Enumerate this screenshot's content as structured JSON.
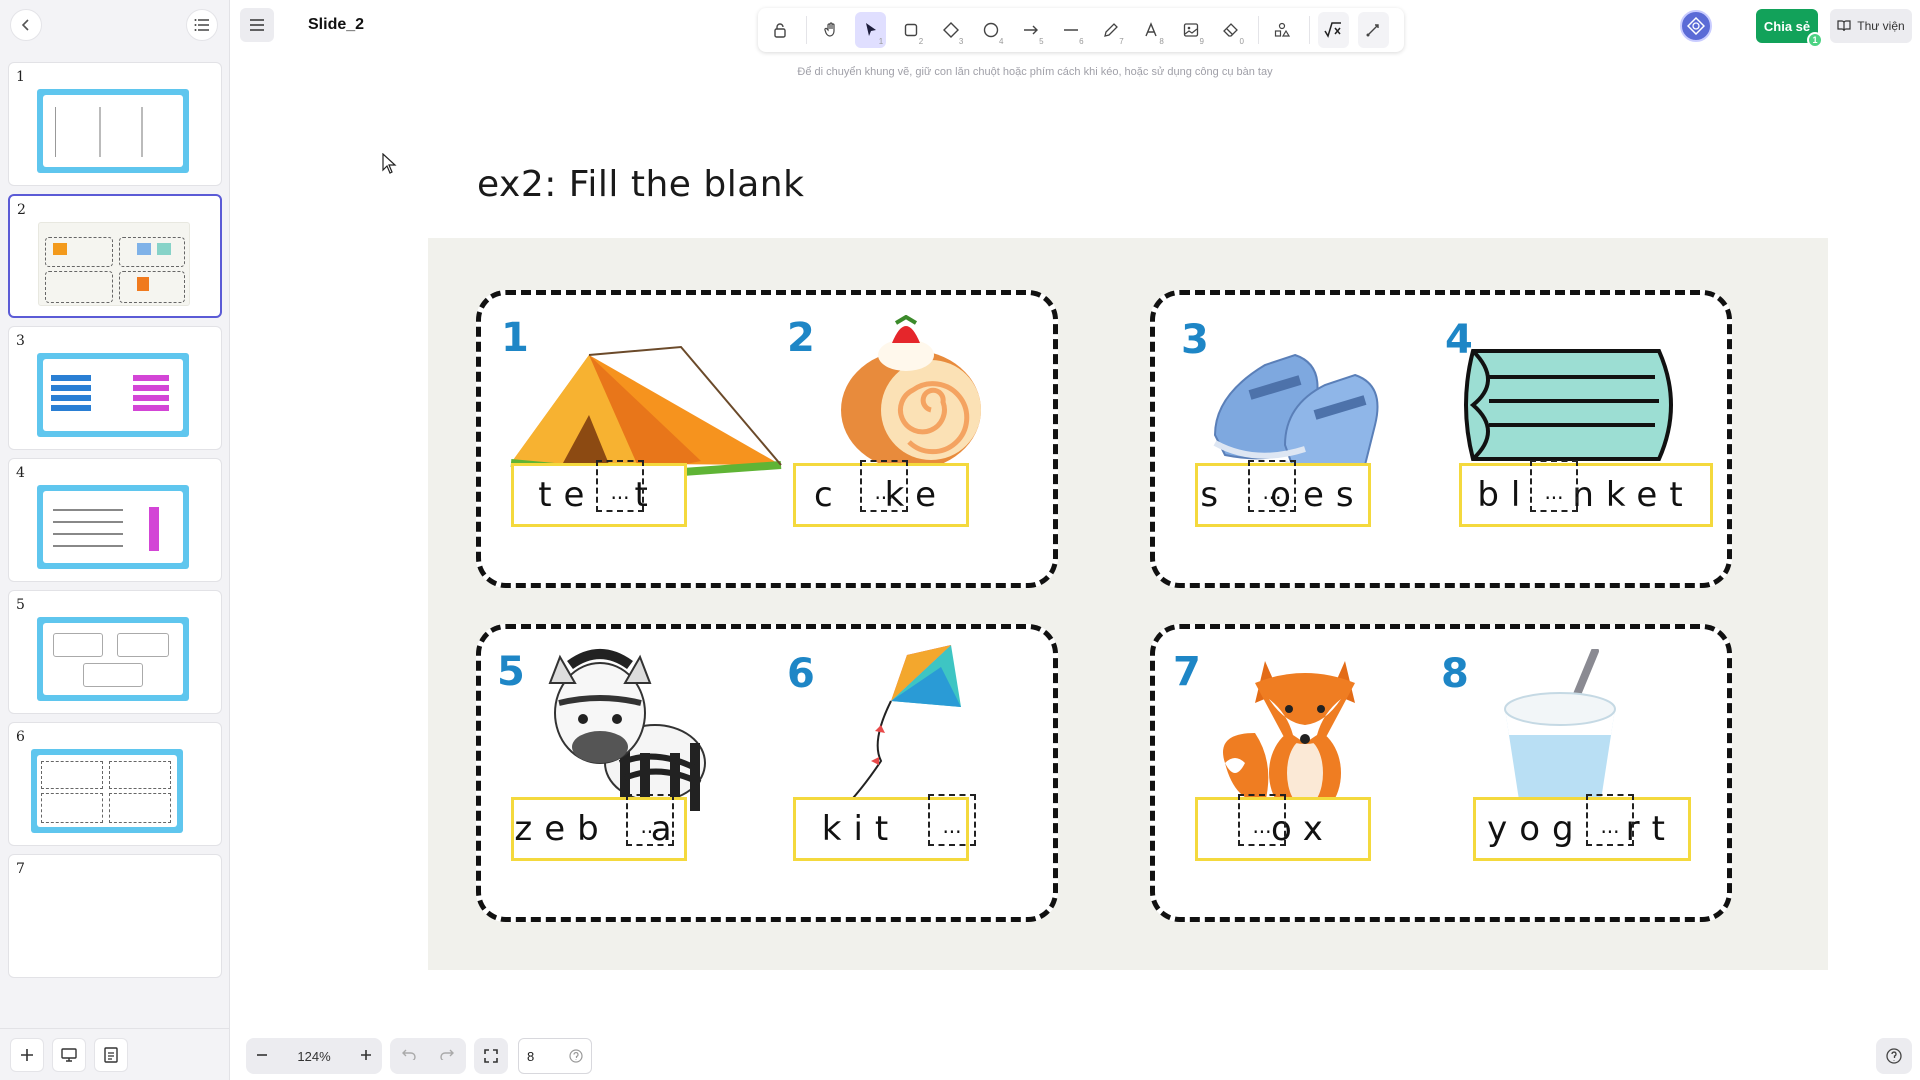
{
  "header": {
    "title": "Slide_2",
    "hint": "Để di chuyển khung vẽ, giữ con lăn chuột hoặc phím cách khi kéo, hoặc sử dụng công cụ bàn tay",
    "share_label": "Chia sẻ",
    "share_count": "1",
    "library_label": "Thư viện"
  },
  "toolbar": {
    "tools": [
      {
        "name": "lock-icon",
        "key": ""
      },
      {
        "name": "hand-icon",
        "key": ""
      },
      {
        "name": "select-icon",
        "key": "1"
      },
      {
        "name": "rectangle-icon",
        "key": "2"
      },
      {
        "name": "diamond-icon",
        "key": "3"
      },
      {
        "name": "ellipse-icon",
        "key": "4"
      },
      {
        "name": "arrow-icon",
        "key": "5"
      },
      {
        "name": "line-icon",
        "key": "6"
      },
      {
        "name": "pencil-icon",
        "key": "7"
      },
      {
        "name": "text-icon",
        "key": "8"
      },
      {
        "name": "image-icon",
        "key": "9"
      },
      {
        "name": "eraser-icon",
        "key": "0"
      },
      {
        "name": "shapes-icon",
        "key": ""
      },
      {
        "name": "formula-icon",
        "key": ""
      },
      {
        "name": "laser-icon",
        "key": ""
      }
    ],
    "active_tool": "select-icon"
  },
  "sidebar": {
    "slides": [
      {
        "number": "1",
        "thumb": "blue"
      },
      {
        "number": "2",
        "thumb": "plain"
      },
      {
        "number": "3",
        "thumb": "blue"
      },
      {
        "number": "4",
        "thumb": "blue"
      },
      {
        "number": "5",
        "thumb": "blue"
      },
      {
        "number": "6",
        "thumb": "blue"
      },
      {
        "number": "7",
        "thumb": "empty"
      }
    ],
    "active_slide": "2"
  },
  "canvas": {
    "heading": "ex2: Fill the blank",
    "items": [
      {
        "number": "1",
        "before": "te",
        "after": "t",
        "picture": "tent"
      },
      {
        "number": "2",
        "before": "c",
        "after": "ke",
        "picture": "cake-roll"
      },
      {
        "number": "3",
        "before": "s",
        "after": "oes",
        "picture": "shoes"
      },
      {
        "number": "4",
        "before": "bl",
        "after": "nket",
        "picture": "blanket"
      },
      {
        "number": "5",
        "before": "zeb",
        "after": "a",
        "picture": "zebra"
      },
      {
        "number": "6",
        "before": "kit",
        "after": "",
        "picture": "kite"
      },
      {
        "number": "7",
        "before": "",
        "after": "ox",
        "picture": "fox"
      },
      {
        "number": "8",
        "before": "yog",
        "after": "rt",
        "picture": "yogurt"
      }
    ],
    "blank_text": "..."
  },
  "bottom": {
    "zoom": "124%",
    "page": "8"
  },
  "colors": {
    "accent": "#5b5bd6",
    "share": "#12a25a",
    "number": "#1e86c6",
    "word_border": "#f4d93d"
  }
}
